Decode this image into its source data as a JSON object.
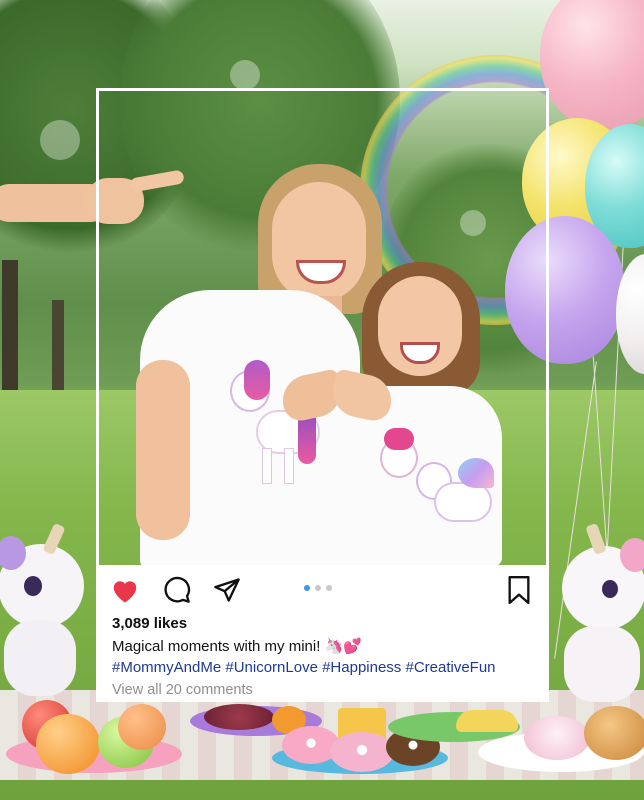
{
  "post": {
    "likes": "3,089 likes",
    "caption": "Magical moments with my mini! 🦄💕",
    "hashtags": "#MommyAndMe #UnicornLove #Happiness #CreativeFun",
    "view_comments": "View all 20 comments"
  },
  "icons": {
    "like": "heart-icon",
    "comment": "comment-icon",
    "share": "paper-plane-icon",
    "save": "bookmark-icon"
  },
  "carousel": {
    "total": 3,
    "active": 1
  },
  "colors": {
    "heart": "#e8364a",
    "hashtag": "#1f3a93",
    "carousel_active": "#3897f0",
    "muted_text": "#8e8e8e"
  }
}
